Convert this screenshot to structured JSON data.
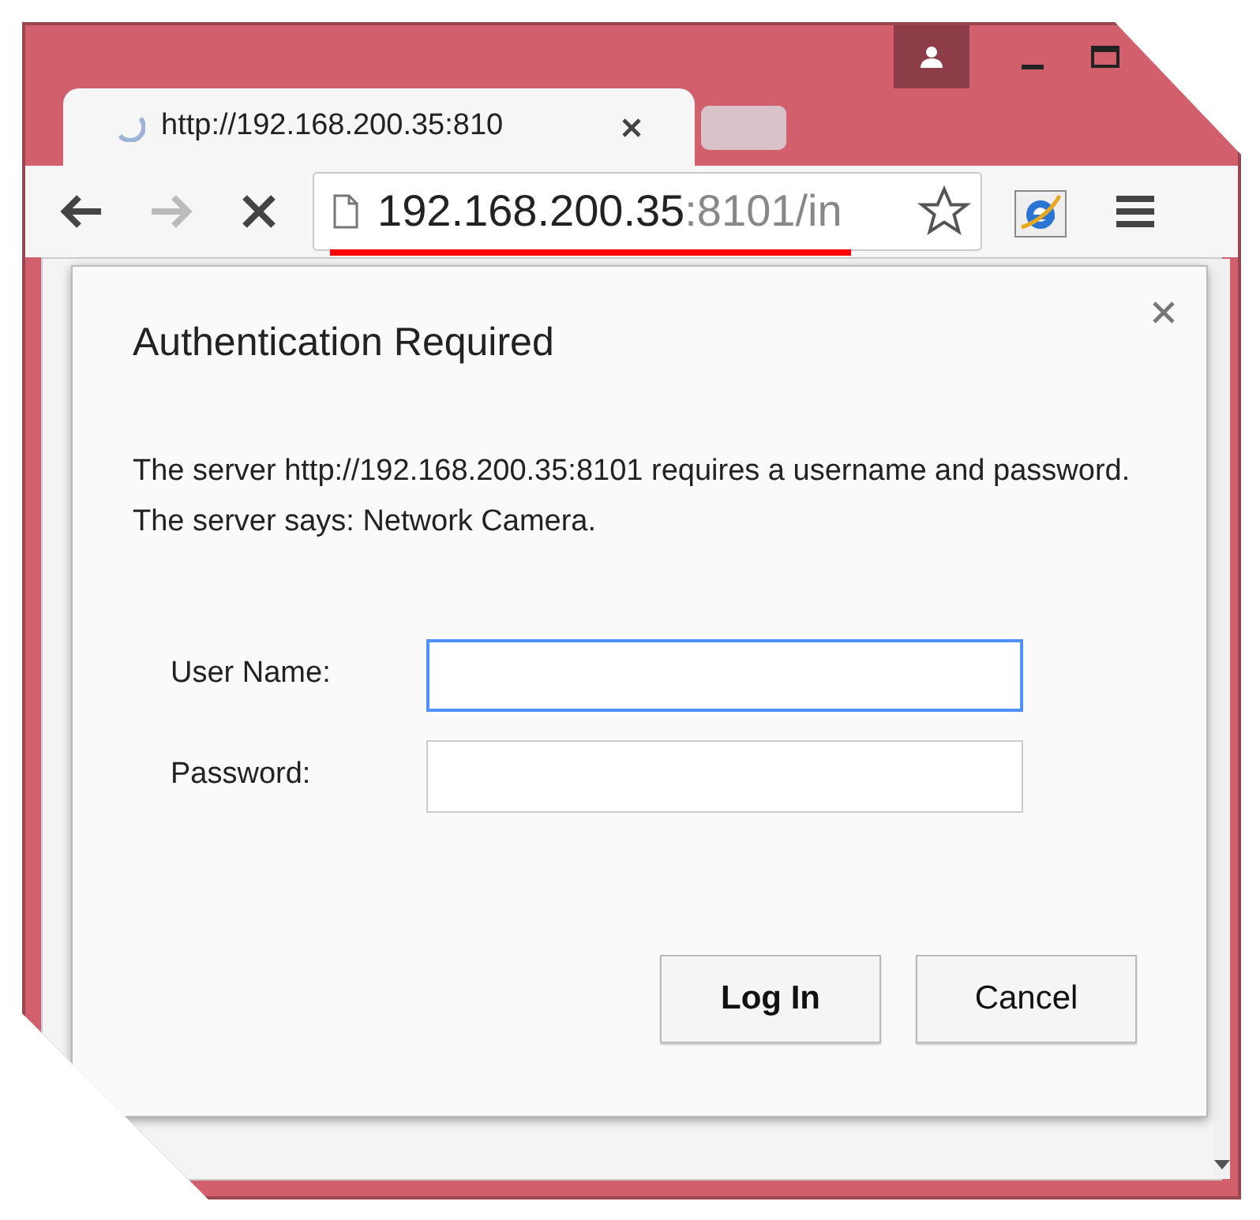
{
  "tab": {
    "title": "http://192.168.200.35:810"
  },
  "address_bar": {
    "host": "192.168.200.35",
    "rest": ":8101/in"
  },
  "dialog": {
    "title": "Authentication Required",
    "message": "The server http://192.168.200.35:8101 requires a username and password. The server says: Network Camera.",
    "fields": [
      {
        "label": "User Name:",
        "focused": true
      },
      {
        "label": "Password:",
        "focused": false
      }
    ],
    "buttons": [
      {
        "label": "Log In",
        "primary": true
      },
      {
        "label": "Cancel",
        "primary": false
      }
    ]
  }
}
